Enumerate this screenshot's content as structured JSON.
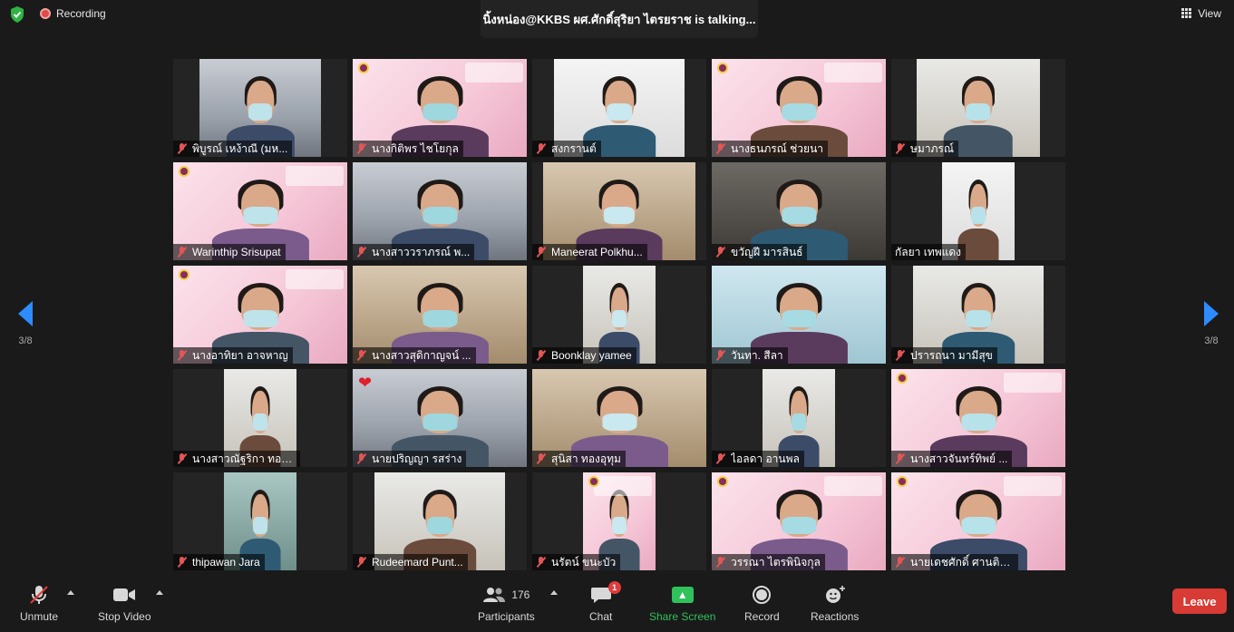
{
  "header": {
    "recording_label": "Recording",
    "talking_text": "นิ้งหน่อง@KKBS ผศ.ศักดิ์สุริยา ไตรยราช  is  talking...",
    "view_label": "View"
  },
  "pager": {
    "left_text": "3/8",
    "right_text": "3/8"
  },
  "participants": [
    {
      "name": "พิบูรณ์ เหง้าณี (มห...",
      "bg": "office"
    },
    {
      "name": "นางกิติพร ไชโยกุล",
      "bg": "pink"
    },
    {
      "name": "สงกรานต์",
      "bg": "white"
    },
    {
      "name": "นางธนภรณ์ ช่วยนา",
      "bg": "pink"
    },
    {
      "name": "ษมาภรณ์",
      "bg": "wall"
    },
    {
      "name": "Warinthip Srisupat",
      "bg": "pink"
    },
    {
      "name": "นางสาววราภรณ์ พ...",
      "bg": "office"
    },
    {
      "name": "Maneerat Polkhu...",
      "bg": "beige"
    },
    {
      "name": "ขวัญฝี มารสินธ์",
      "bg": "dark"
    },
    {
      "name": "กัลยา เทพแดง",
      "bg": "white"
    },
    {
      "name": "นางอาทิยา อาจหาญ",
      "bg": "pink"
    },
    {
      "name": "นางสาวสุดิกาญจน์ ...",
      "bg": "beige"
    },
    {
      "name": "Boonklay  yamee",
      "bg": "wall"
    },
    {
      "name": "วันทา. สีลา",
      "bg": "teal"
    },
    {
      "name": "ปรารถนา มามีสุข",
      "bg": "wall"
    },
    {
      "name": "นางสาวณัฐริกา ทอง...",
      "bg": "wall"
    },
    {
      "name": "นายปริญญา รสร่าง",
      "bg": "office"
    },
    {
      "name": "สุนิสา  ทองอุทุม",
      "bg": "beige"
    },
    {
      "name": "ไอลดา อานพล",
      "bg": "wall"
    },
    {
      "name": "นางสาวจันทร์ทิพย์ ...",
      "bg": "pink"
    },
    {
      "name": "thipawan Jara",
      "bg": "green"
    },
    {
      "name": "Rudeemard Punt...",
      "bg": "wall"
    },
    {
      "name": "นรัตน์ ขนะบัว",
      "bg": "pink"
    },
    {
      "name": "วรรณา ไตรพินิจกุล",
      "bg": "pink"
    },
    {
      "name": "นายเดชศักดิ์ ศานติว...",
      "bg": "pink"
    }
  ],
  "reaction": {
    "icon": "heart-icon",
    "symbol": "❤"
  },
  "toolbar": {
    "unmute_label": "Unmute",
    "stop_video_label": "Stop Video",
    "participants_label": "Participants",
    "participants_count": "176",
    "chat_label": "Chat",
    "chat_badge": "1",
    "share_label": "Share Screen",
    "record_label": "Record",
    "reactions_label": "Reactions",
    "leave_label": "Leave"
  },
  "colors": {
    "accent_blue": "#2d8cff",
    "share_green": "#2fc15a",
    "leave_red": "#d83a34",
    "background": "#1a1a1a"
  }
}
